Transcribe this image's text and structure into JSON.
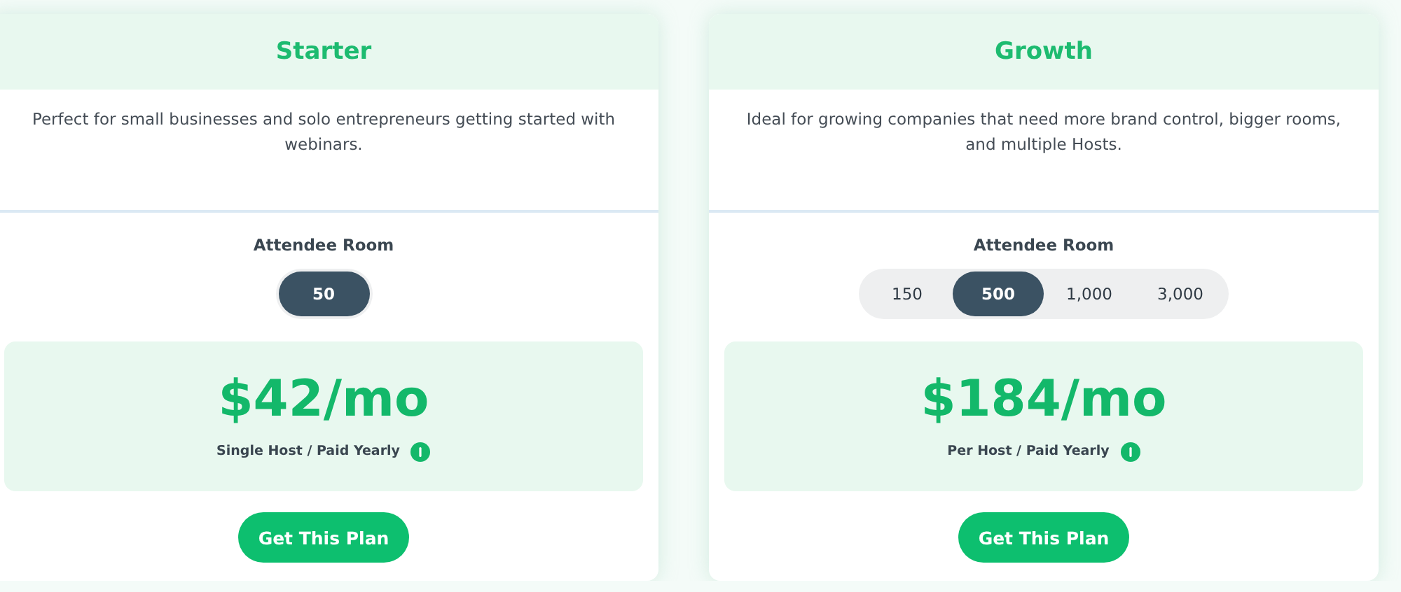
{
  "plans": [
    {
      "title": "Starter",
      "description": "Perfect for small businesses and solo entrepreneurs getting started with webinars.",
      "room_label": "Attendee Room",
      "room_options": [
        {
          "label": "50",
          "selected": true
        }
      ],
      "price": "$42/mo",
      "billing": "Single Host / Paid Yearly",
      "button": "Get This Plan"
    },
    {
      "title": "Growth",
      "description": "Ideal for growing companies that need more brand control, bigger rooms, and multiple Hosts.",
      "room_label": "Attendee Room",
      "room_options": [
        {
          "label": "150",
          "selected": false
        },
        {
          "label": "500",
          "selected": true
        },
        {
          "label": "1,000",
          "selected": false
        },
        {
          "label": "3,000",
          "selected": false
        }
      ],
      "price": "$184/mo",
      "billing": "Per Host / Paid Yearly",
      "button": "Get This Plan"
    }
  ]
}
